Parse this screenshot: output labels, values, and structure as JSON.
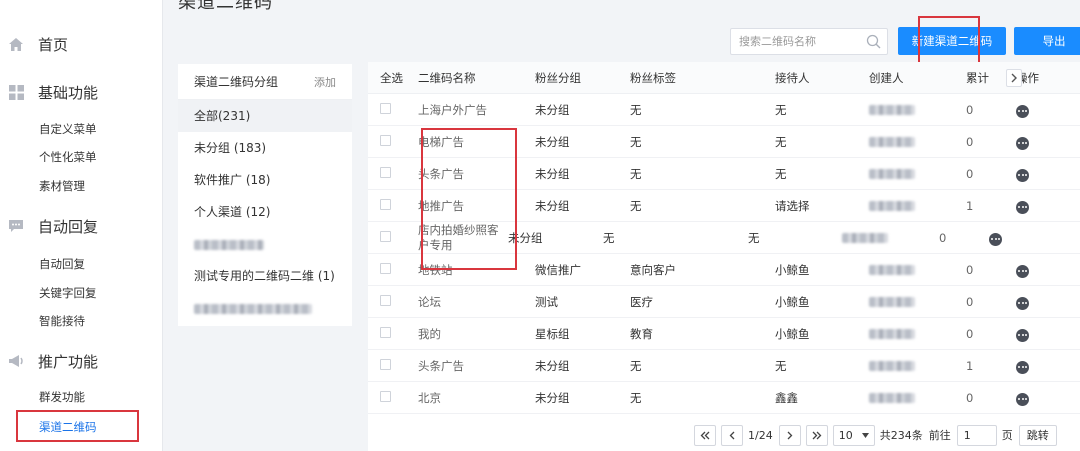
{
  "page": {
    "title": "渠道二维码"
  },
  "sidebar": {
    "sections": [
      {
        "label": "首页",
        "icon": "home-icon"
      },
      {
        "label": "基础功能",
        "icon": "grid-icon",
        "items": [
          "自定义菜单",
          "个性化菜单",
          "素材管理"
        ]
      },
      {
        "label": "自动回复",
        "icon": "chat-icon",
        "items": [
          "自动回复",
          "关键字回复",
          "智能接待"
        ]
      },
      {
        "label": "推广功能",
        "icon": "megaphone-icon",
        "items": [
          "群发功能",
          "渠道二维码"
        ]
      }
    ],
    "active_item": "渠道二维码"
  },
  "header": {
    "search_placeholder": "搜索二维码名称",
    "new_button": "新建渠道二维码",
    "export_button": "导出"
  },
  "groups": {
    "title": "渠道二维码分组",
    "add_label": "添加",
    "items": [
      "全部(231)",
      "未分组 (183)",
      "软件推广 (18)",
      "个人渠道 (12)",
      "",
      "测试专用的二维码二维 (1)",
      ""
    ]
  },
  "table": {
    "columns": [
      "全选",
      "二维码名称",
      "粉丝分组",
      "粉丝标签",
      "接待人",
      "创建人",
      "累计",
      "操作"
    ],
    "rows": [
      {
        "name": "上海户外广告",
        "group": "未分组",
        "tag": "无",
        "receiver": "无",
        "total": "0"
      },
      {
        "name": "电梯广告",
        "group": "未分组",
        "tag": "无",
        "receiver": "无",
        "total": "0"
      },
      {
        "name": "头条广告",
        "group": "未分组",
        "tag": "无",
        "receiver": "无",
        "total": "0"
      },
      {
        "name": "地推广告",
        "group": "未分组",
        "tag": "无",
        "receiver": "请选择",
        "total": "1"
      },
      {
        "name": "店内拍婚纱照客户专用",
        "group": "未分组",
        "tag": "无",
        "receiver": "无",
        "total": "0"
      },
      {
        "name": "地铁站",
        "group": "微信推广",
        "tag": "意向客户",
        "receiver": "小鲸鱼",
        "total": "0"
      },
      {
        "name": "论坛",
        "group": "测试",
        "tag": "医疗",
        "receiver": "小鲸鱼",
        "total": "0"
      },
      {
        "name": "我的",
        "group": "星标组",
        "tag": "教育",
        "receiver": "小鲸鱼",
        "total": "0"
      },
      {
        "name": "头条广告",
        "group": "未分组",
        "tag": "无",
        "receiver": "无",
        "total": "1"
      },
      {
        "name": "北京",
        "group": "未分组",
        "tag": "无",
        "receiver": "鑫鑫",
        "total": "0"
      }
    ]
  },
  "pagination": {
    "current": "1/24",
    "page_size": "10",
    "total": "共234条",
    "goto_label": "前往",
    "goto_value": "1",
    "page_unit": "页",
    "jump_button": "跳转"
  },
  "colors": {
    "accent": "#1a8cff",
    "highlight_box": "#d9363e",
    "active_nav": "#1a73e8"
  }
}
